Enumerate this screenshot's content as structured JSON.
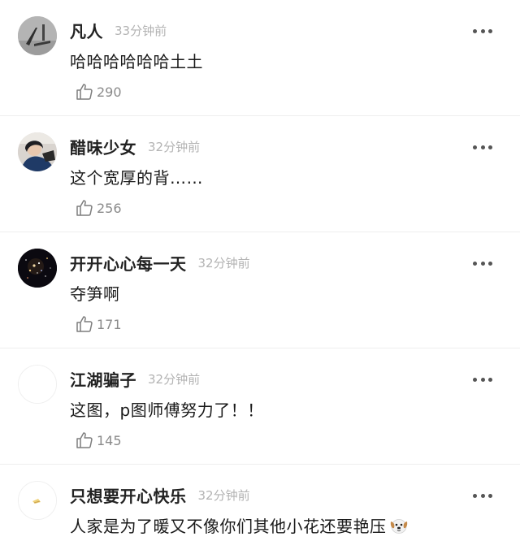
{
  "comments": [
    {
      "username": "凡人",
      "time": "33分钟前",
      "text": "哈哈哈哈哈哈土土",
      "likes": "290",
      "avatar": "grey-sketch-avatar"
    },
    {
      "username": "醋味少女",
      "time": "32分钟前",
      "text": "这个宽厚的背……",
      "likes": "256",
      "avatar": "girl-photo-avatar"
    },
    {
      "username": "开开心心每一天",
      "time": "32分钟前",
      "text": "夺笋啊",
      "likes": "171",
      "avatar": "starry-night-avatar"
    },
    {
      "username": "江湖骗子",
      "time": "32分钟前",
      "text": "这图，p图师傅努力了！！",
      "likes": "145",
      "avatar": "blank-white-avatar"
    },
    {
      "username": "只想要开心快乐",
      "time": "32分钟前",
      "text": "人家是为了暖又不像你们其他小花还要艳压",
      "likes": "",
      "avatar": "small-drawing-avatar",
      "emoji": "dog-face-emoji"
    }
  ],
  "icons": {
    "more": "more-dots-icon",
    "like": "thumbs-up-icon"
  },
  "colors": {
    "username": "#222222",
    "time": "#b3b3b3",
    "like_count": "#8a8a8a",
    "divider": "#eeeeee"
  }
}
